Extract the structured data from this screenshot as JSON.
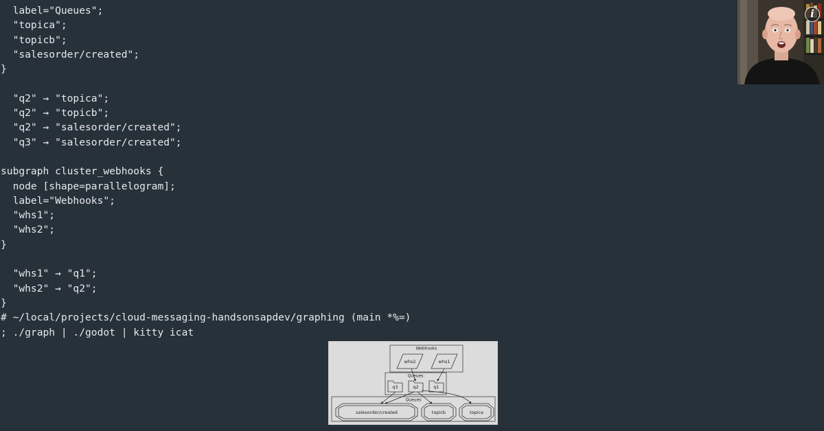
{
  "terminal": {
    "lines": [
      "  label=\"Queues\";",
      "  \"topica\";",
      "  \"topicb\";",
      "  \"salesorder/created\";",
      "}",
      "",
      "  \"q2\" → \"topica\";",
      "  \"q2\" → \"topicb\";",
      "  \"q2\" → \"salesorder/created\";",
      "  \"q3\" → \"salesorder/created\";",
      "",
      "subgraph cluster_webhooks {",
      "  node [shape=parallelogram];",
      "  label=\"Webhooks\";",
      "  \"whs1\";",
      "  \"whs2\";",
      "}",
      "",
      "  \"whs1\" → \"q1\";",
      "  \"whs2\" → \"q2\";",
      "}",
      "# ~/local/projects/cloud-messaging-handsonsapdev/graphing (main *%=)",
      "; ./graph | ./godot | kitty icat"
    ]
  },
  "webcam": {
    "info_icon_glyph": "i",
    "icon": "info-icon"
  },
  "graph": {
    "webhooks_label": "Webhooks",
    "queues_top_label": "Queues",
    "queues_bottom_label": "Queues",
    "whs2": "whs2",
    "whs1": "whs1",
    "q3": "q3",
    "q2": "q2",
    "q1": "q1",
    "salesorder": "salesorder/created",
    "topicb": "topicb",
    "topica": "topica"
  },
  "colors": {
    "background": "#27313a",
    "text": "#e6e9ec",
    "graph_background": "#dcdcdc"
  }
}
